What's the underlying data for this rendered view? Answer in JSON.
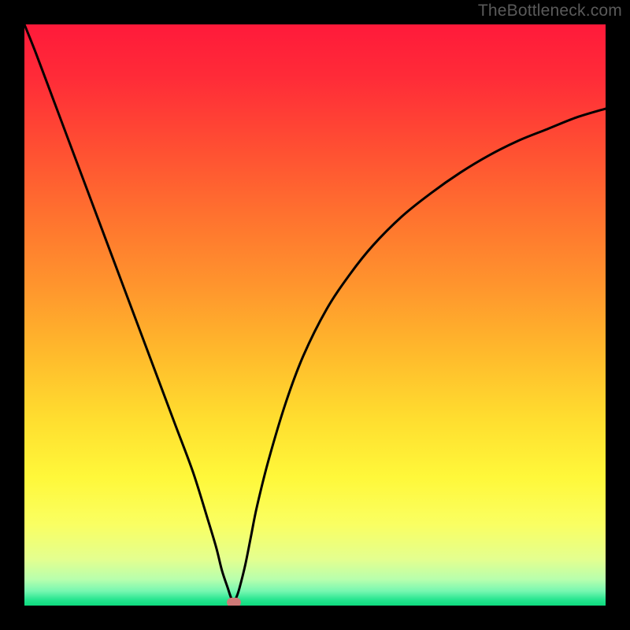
{
  "watermark": "TheBottleneck.com",
  "chart_data": {
    "type": "line",
    "title": "",
    "xlabel": "",
    "ylabel": "",
    "xlim": [
      0,
      100
    ],
    "ylim": [
      0,
      100
    ],
    "series": [
      {
        "name": "bottleneck-curve",
        "x": [
          0,
          2,
          5,
          8,
          11,
          14,
          17,
          20,
          23,
          26,
          29,
          31.5,
          33,
          34,
          35,
          35.5,
          36,
          36.5,
          37,
          38,
          39,
          40,
          42,
          45,
          48,
          52,
          56,
          60,
          65,
          70,
          75,
          80,
          85,
          90,
          95,
          100
        ],
        "values": [
          100,
          95,
          87,
          79,
          71,
          63,
          55,
          47,
          39,
          31,
          23,
          15,
          10,
          6,
          3,
          1.5,
          0.5,
          1.5,
          3,
          7,
          12,
          17,
          25,
          35,
          43,
          51,
          57,
          62,
          67,
          71,
          74.5,
          77.5,
          80,
          82,
          84,
          85.5
        ]
      }
    ],
    "marker": {
      "x": 36,
      "y": 0.5
    },
    "gradient": {
      "stops": [
        {
          "pos": 0.0,
          "color": "#ff1a3a"
        },
        {
          "pos": 0.09,
          "color": "#ff2b38"
        },
        {
          "pos": 0.2,
          "color": "#ff4b33"
        },
        {
          "pos": 0.32,
          "color": "#ff6f2f"
        },
        {
          "pos": 0.45,
          "color": "#ff952d"
        },
        {
          "pos": 0.57,
          "color": "#ffbb2c"
        },
        {
          "pos": 0.68,
          "color": "#ffde2f"
        },
        {
          "pos": 0.78,
          "color": "#fff83a"
        },
        {
          "pos": 0.86,
          "color": "#faff62"
        },
        {
          "pos": 0.92,
          "color": "#e4ff8f"
        },
        {
          "pos": 0.955,
          "color": "#b8ffad"
        },
        {
          "pos": 0.975,
          "color": "#77f7b1"
        },
        {
          "pos": 0.99,
          "color": "#26e58f"
        },
        {
          "pos": 1.0,
          "color": "#0edb7e"
        }
      ]
    }
  }
}
